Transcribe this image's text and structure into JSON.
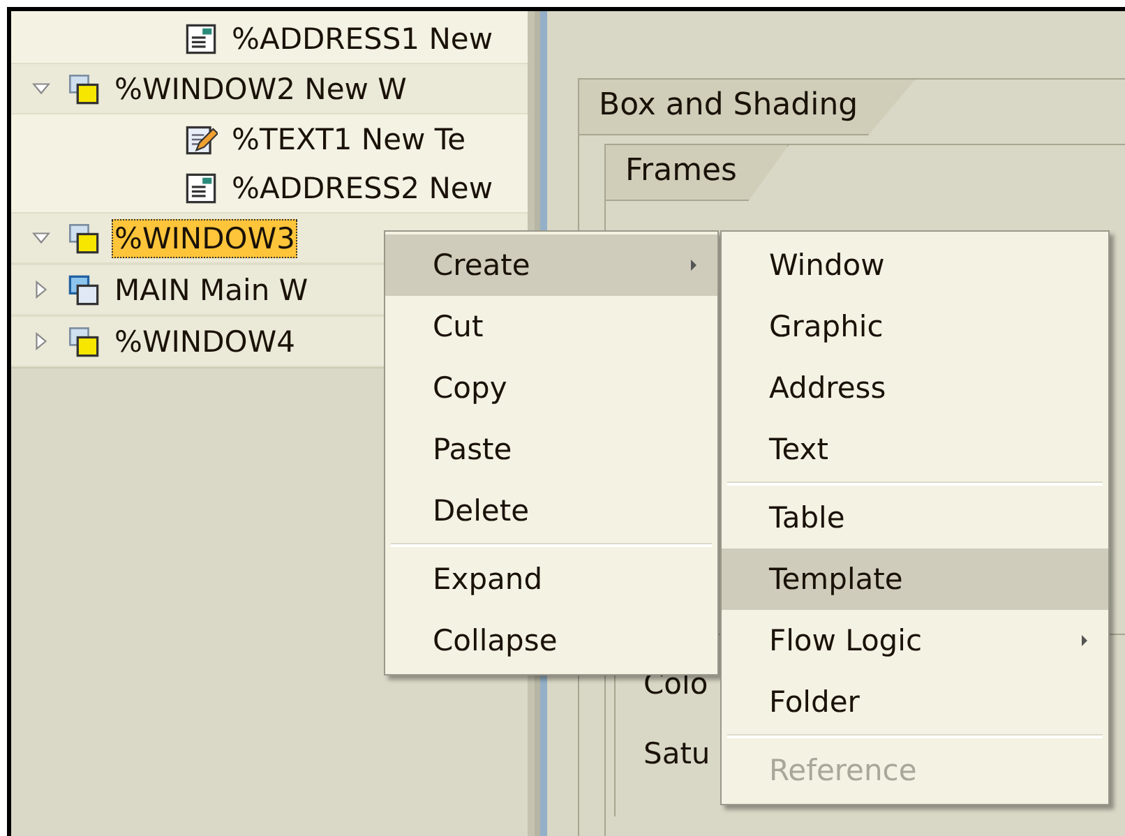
{
  "tree": {
    "items": [
      {
        "children": [
          {
            "kind": "address",
            "label": "%ADDRESS1 New",
            "selected": false
          }
        ]
      },
      {
        "kind": "window",
        "label": "%WINDOW2 New W",
        "expanded": true,
        "selected": false,
        "children": [
          {
            "kind": "text",
            "label": "%TEXT1 New Te",
            "selected": false
          },
          {
            "kind": "address",
            "label": "%ADDRESS2 New",
            "selected": false
          }
        ]
      },
      {
        "kind": "window",
        "label": "%WINDOW3",
        "expanded": true,
        "selected": true
      },
      {
        "kind": "main_window",
        "label": "MAIN Main W",
        "expanded": false,
        "selected": false
      },
      {
        "kind": "window",
        "label": "%WINDOW4",
        "expanded": false,
        "selected": false
      }
    ]
  },
  "tabs": {
    "outer": "Box and Shading",
    "inner": "Frames"
  },
  "fields": [
    {
      "label": "Colo"
    },
    {
      "label": "Satu"
    }
  ],
  "context_menu": [
    {
      "kind": "item",
      "label": "Create",
      "selected": true,
      "submenu": true
    },
    {
      "kind": "item",
      "label": "Cut",
      "selected": false,
      "submenu": false
    },
    {
      "kind": "item",
      "label": "Copy",
      "selected": false,
      "submenu": false
    },
    {
      "kind": "item",
      "label": "Paste",
      "selected": false,
      "submenu": false
    },
    {
      "kind": "item",
      "label": "Delete",
      "selected": false,
      "submenu": false
    },
    {
      "kind": "separator"
    },
    {
      "kind": "item",
      "label": "Expand",
      "selected": false,
      "submenu": false
    },
    {
      "kind": "item",
      "label": "Collapse",
      "selected": false,
      "submenu": false
    }
  ],
  "submenu": [
    {
      "kind": "item",
      "label": "Window",
      "selected": false,
      "submenu": false,
      "disabled": false
    },
    {
      "kind": "item",
      "label": "Graphic",
      "selected": false,
      "submenu": false,
      "disabled": false
    },
    {
      "kind": "item",
      "label": "Address",
      "selected": false,
      "submenu": false,
      "disabled": false
    },
    {
      "kind": "item",
      "label": "Text",
      "selected": false,
      "submenu": false,
      "disabled": false
    },
    {
      "kind": "separator"
    },
    {
      "kind": "item",
      "label": "Table",
      "selected": false,
      "submenu": false,
      "disabled": false
    },
    {
      "kind": "item",
      "label": "Template",
      "selected": true,
      "submenu": false,
      "disabled": false
    },
    {
      "kind": "item",
      "label": "Flow Logic",
      "selected": false,
      "submenu": true,
      "disabled": false
    },
    {
      "kind": "item",
      "label": "Folder",
      "selected": false,
      "submenu": false,
      "disabled": false
    },
    {
      "kind": "separator"
    },
    {
      "kind": "item",
      "label": "Reference",
      "selected": false,
      "submenu": false,
      "disabled": true
    }
  ]
}
